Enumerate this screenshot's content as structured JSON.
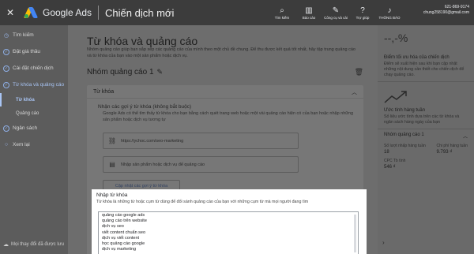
{
  "topbar": {
    "close_glyph": "✕",
    "brand": "Google Ads",
    "title": "Chiến dịch mới",
    "tools": [
      {
        "icon": "search-icon",
        "glyph": "⌕",
        "label": "Tìm kiếm"
      },
      {
        "icon": "chart-icon",
        "glyph": "▥",
        "label": "Báo cáo"
      },
      {
        "icon": "wrench-icon",
        "glyph": "✎",
        "label": "Công cụ và cài"
      },
      {
        "icon": "help-icon",
        "glyph": "?",
        "label": "Trợ giúp"
      },
      {
        "icon": "bell-icon",
        "glyph": "♪",
        "label": "THÔNG BÁO"
      }
    ],
    "account_id": "621-869-9174",
    "account_email": "chung258190@gmail.com"
  },
  "leftnav": {
    "items": [
      {
        "icon": "clock-icon",
        "glyph": "◷",
        "label": "Tìm kiếm"
      },
      {
        "icon": "check-icon",
        "glyph": "✓",
        "label": "Đặt giá thầu"
      },
      {
        "icon": "check-icon",
        "glyph": "✓",
        "label": "Cài đặt chiến dịch"
      },
      {
        "icon": "check-icon",
        "glyph": "✓",
        "label": "Từ khóa và quảng cáo"
      },
      {
        "label": "Từ khóa"
      },
      {
        "label": "Quảng cáo"
      },
      {
        "icon": "check-icon",
        "glyph": "✓",
        "label": "Ngân sách"
      },
      {
        "icon": "radio-icon",
        "glyph": "○",
        "label": "Xem lại"
      }
    ],
    "footer": "Mọi thay đổi đã được lưu",
    "footer_glyph": "☁"
  },
  "main": {
    "title": "Từ khóa và quảng cáo",
    "description": "Nhóm quảng cáo giúp bạn sắp xếp các quảng cáo của mình theo một chủ đề chung. Để thu được kết quả tốt nhất, hãy tập trung quảng cáo và từ khóa của bạn vào một sản phẩm hoặc dịch vụ.",
    "ad_group": "Nhóm quảng cáo 1",
    "pencil_glyph": "✎",
    "trash_glyph": "🗑",
    "card": {
      "header": "Từ khóa",
      "chevron": "︿",
      "suggest_title": "Nhận các gợi ý từ khóa (không bắt buộc)",
      "suggest_desc": "Google Ads có thể tìm thấy từ khóa cho bạn bằng cách quét trang web hoặc một vài quảng cáo hiện có của bạn hoặc nhập những sản phẩm hoặc dịch vụ tương tự",
      "url_field": "https://ychoc.com/seo-marketing",
      "link_glyph": "⛓",
      "product_placeholder": "Nhập sản phẩm hoặc dịch vụ để quảng cáo",
      "list_glyph": "▤",
      "generate_button": "Cập nhật các gợi ý từ khóa"
    }
  },
  "keywords": {
    "title": "Nhập từ khóa",
    "subtitle": "Từ khóa là những từ hoặc cụm từ dùng để đối sánh quảng cáo của bạn với những cụm từ mà mọi người đang tìm",
    "list": [
      "quảng cáo google ads",
      "quảng cáo trên website",
      "dịch vụ seo",
      "viết content chuẩn seo",
      "dịch vụ viết content",
      "học quảng cáo google",
      "dịch vụ marketing"
    ]
  },
  "rightpanel": {
    "percent": "--,-%",
    "opt_title": "Điểm tối ưu hóa của chiến dịch",
    "opt_desc": "Điểm sẽ xuất hiện sau khi bạn cập nhật những nội dung cần thiết cho chiến dịch để chạy quảng cáo.",
    "weekly_title": "Ước tính hàng tuần",
    "weekly_desc": "Số liệu ước tính dựa trên các từ khóa và ngân sách hàng ngày của bạn",
    "group_label": "Nhóm quảng cáo 1",
    "chevron": "︿",
    "stats": [
      {
        "label": "Số lượt nhấp hàng tuần",
        "value": "18"
      },
      {
        "label": "Chi phí hàng tuần",
        "value": "9.793 ₫"
      }
    ],
    "cpc_label": "CPC Tb tính",
    "cpc_value": "546 ₫",
    "expand_glyph": "›"
  }
}
